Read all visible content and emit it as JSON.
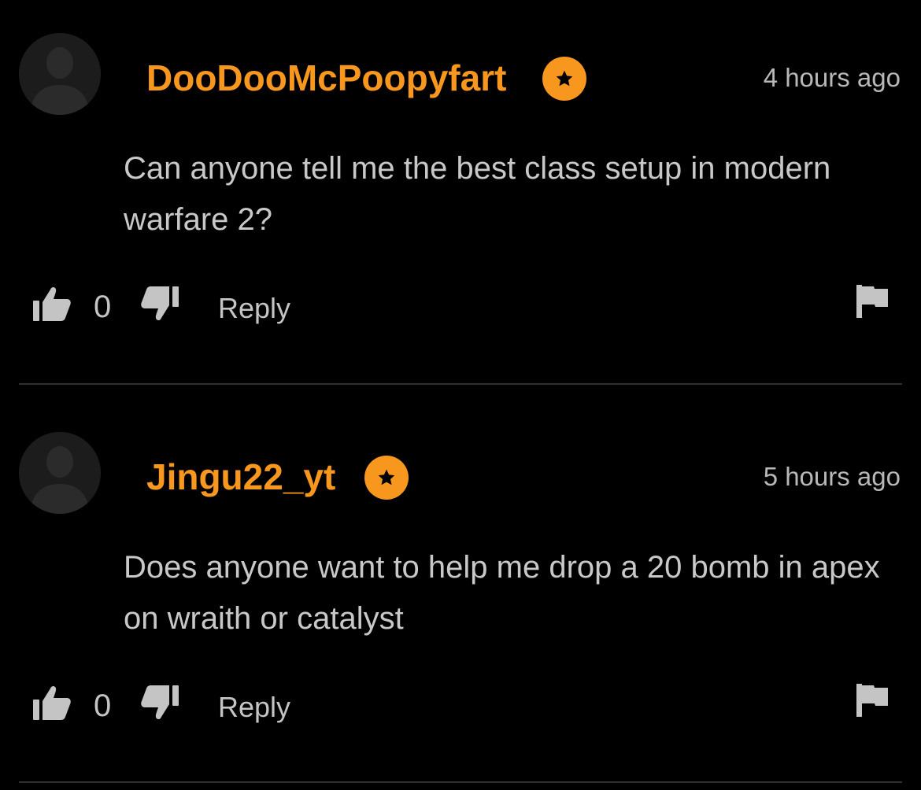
{
  "theme": {
    "background": "#000000",
    "accent": "#f7971d",
    "text": "#c4c4c4",
    "divider": "#303030"
  },
  "icons": {
    "avatar": "user-silhouette-icon",
    "badge": "star-icon",
    "like": "thumbs-up-icon",
    "dislike": "thumbs-down-icon",
    "report": "flag-icon"
  },
  "comments": [
    {
      "username": "DooDooMcPoopyfart",
      "timestamp": "4 hours ago",
      "text": "Can anyone tell me the best class setup in modern warfare 2?",
      "like_count": "0",
      "reply_label": "Reply"
    },
    {
      "username": "Jingu22_yt",
      "timestamp": "5 hours ago",
      "text": "Does anyone want to help me drop a 20 bomb in apex on wraith or catalyst",
      "like_count": "0",
      "reply_label": "Reply"
    }
  ]
}
